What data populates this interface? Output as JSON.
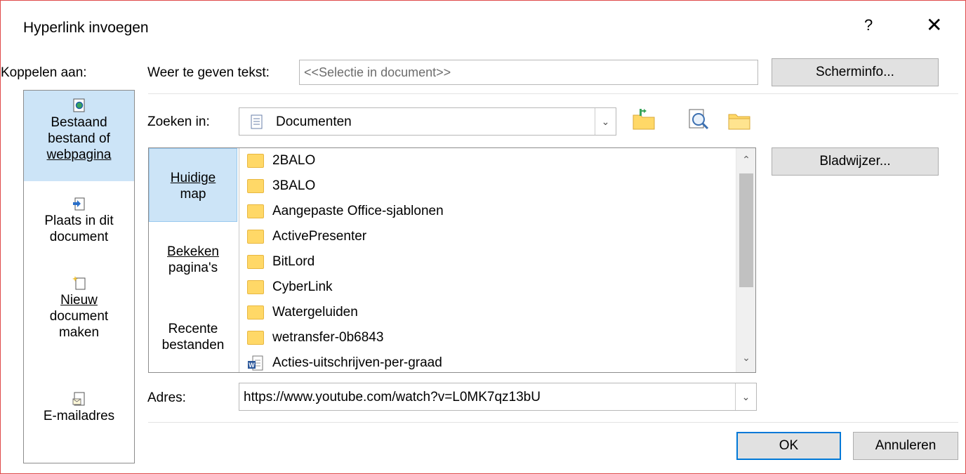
{
  "dialog": {
    "title": "Hyperlink invoegen",
    "help_glyph": "?",
    "close_glyph": "✕"
  },
  "link_to": {
    "label": "Koppelen aan:",
    "items": [
      {
        "lines": [
          "Bestaand",
          "bestand of",
          "webpagina"
        ],
        "icon": "existing-file-icon",
        "selected": true
      },
      {
        "lines": [
          "Plaats in dit",
          "document"
        ],
        "icon": "place-in-document-icon"
      },
      {
        "lines": [
          "Nieuw",
          "document",
          "maken"
        ],
        "icon": "new-document-icon"
      },
      {
        "lines": [
          "E-mailadres"
        ],
        "icon": "email-icon"
      }
    ]
  },
  "display_text": {
    "label": "Weer te geven tekst:",
    "value": "<<Selectie in document>>"
  },
  "screentip_button": "Scherminfo...",
  "look_in": {
    "label": "Zoeken in:",
    "value": "Documenten",
    "icon": "documents-folder-icon"
  },
  "toolbar_icons": [
    "up-folder-icon",
    "browse-web-icon",
    "browse-file-icon"
  ],
  "bookmark_button": "Bladwijzer...",
  "browser": {
    "sidebar": [
      {
        "lines": [
          "Huidige",
          "map"
        ],
        "selected": true
      },
      {
        "lines": [
          "Bekeken",
          "pagina's"
        ]
      },
      {
        "lines": [
          "Recente",
          "bestanden"
        ]
      }
    ],
    "files": [
      {
        "name": "2BALO",
        "type": "folder"
      },
      {
        "name": "3BALO",
        "type": "folder"
      },
      {
        "name": "Aangepaste Office-sjablonen",
        "type": "folder"
      },
      {
        "name": "ActivePresenter",
        "type": "folder"
      },
      {
        "name": "BitLord",
        "type": "folder"
      },
      {
        "name": "CyberLink",
        "type": "folder"
      },
      {
        "name": "Watergeluiden",
        "type": "folder"
      },
      {
        "name": "wetransfer-0b6843",
        "type": "folder"
      },
      {
        "name": "Acties-uitschrijven-per-graad",
        "type": "word-document"
      }
    ]
  },
  "address": {
    "label": "Adres:",
    "value": "https://www.youtube.com/watch?v=L0MK7qz13bU"
  },
  "buttons": {
    "ok": "OK",
    "cancel": "Annuleren"
  },
  "colors": {
    "selection": "#cce4f7",
    "accent": "#0078d7",
    "dialog_border": "#e04a4a",
    "folder": "#ffd867"
  }
}
